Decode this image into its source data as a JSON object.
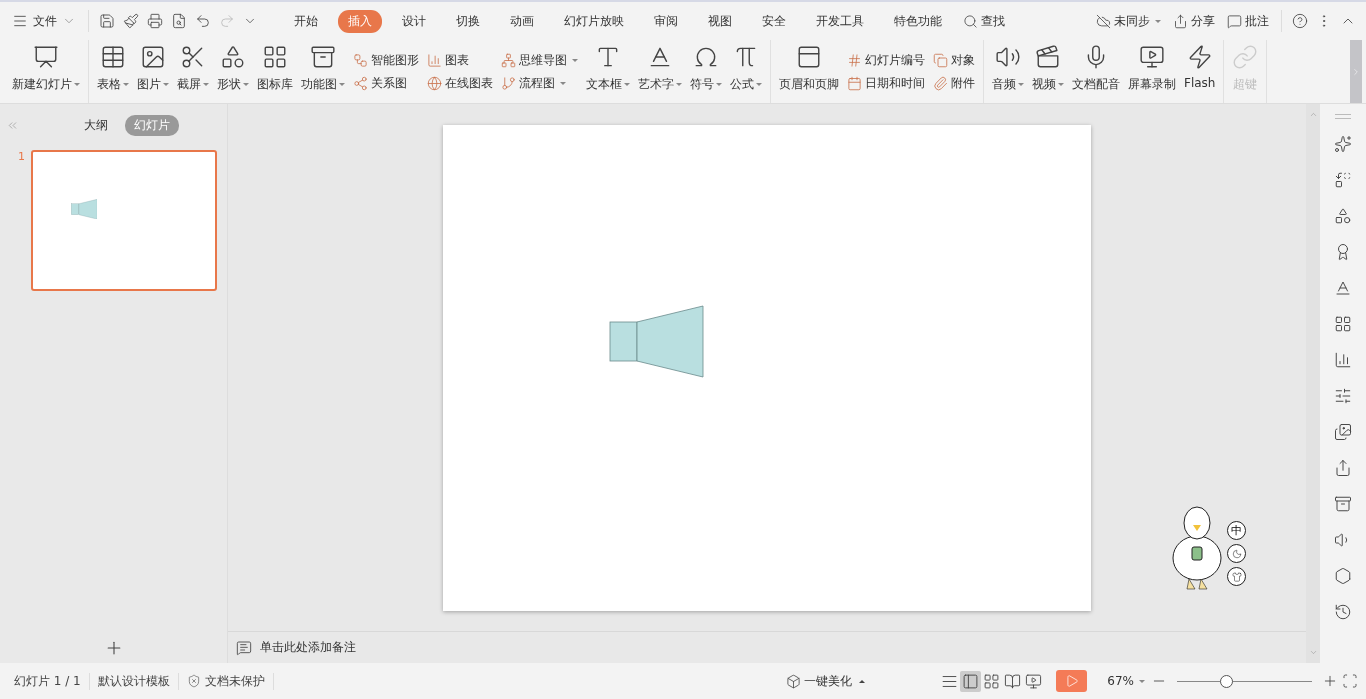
{
  "menu": {
    "label": "文件"
  },
  "tabs": [
    {
      "label": "开始",
      "selected": false
    },
    {
      "label": "插入",
      "selected": true
    },
    {
      "label": "设计",
      "selected": false
    },
    {
      "label": "切换",
      "selected": false
    },
    {
      "label": "动画",
      "selected": false
    },
    {
      "label": "幻灯片放映",
      "selected": false
    },
    {
      "label": "审阅",
      "selected": false
    },
    {
      "label": "视图",
      "selected": false
    },
    {
      "label": "安全",
      "selected": false
    },
    {
      "label": "开发工具",
      "selected": false
    },
    {
      "label": "特色功能",
      "selected": false
    }
  ],
  "search": {
    "label": "查找"
  },
  "top_actions": [
    {
      "label": "未同步",
      "dropdown": true
    },
    {
      "label": "分享",
      "dropdown": false
    },
    {
      "label": "批注",
      "dropdown": false
    }
  ],
  "ribbon": {
    "groups": [
      {
        "columns": [
          {
            "kind": "large",
            "label": "新建幻灯片",
            "dropdown": true,
            "disabled": false
          }
        ]
      },
      {
        "columns": [
          {
            "kind": "large",
            "label": "表格",
            "dropdown": true,
            "disabled": false
          },
          {
            "kind": "large",
            "label": "图片",
            "dropdown": true,
            "disabled": false
          },
          {
            "kind": "large",
            "label": "截屏",
            "dropdown": true,
            "disabled": false
          },
          {
            "kind": "large",
            "label": "形状",
            "dropdown": true,
            "disabled": false
          },
          {
            "kind": "large",
            "label": "图标库",
            "dropdown": false,
            "disabled": false
          },
          {
            "kind": "large",
            "label": "功能图",
            "dropdown": true,
            "disabled": false
          },
          {
            "kind": "stack",
            "items": [
              {
                "label": "智能图形",
                "dropdown": false
              },
              {
                "label": "关系图",
                "dropdown": false
              }
            ]
          },
          {
            "kind": "stack",
            "items": [
              {
                "label": "图表",
                "dropdown": false
              },
              {
                "label": "在线图表",
                "dropdown": false
              }
            ]
          },
          {
            "kind": "stack",
            "items": [
              {
                "label": "思维导图",
                "dropdown": true
              },
              {
                "label": "流程图",
                "dropdown": true
              }
            ]
          },
          {
            "kind": "large",
            "label": "文本框",
            "dropdown": true,
            "disabled": false
          },
          {
            "kind": "large",
            "label": "艺术字",
            "dropdown": true,
            "disabled": false
          },
          {
            "kind": "large",
            "label": "符号",
            "dropdown": true,
            "disabled": false
          },
          {
            "kind": "large",
            "label": "公式",
            "dropdown": true,
            "disabled": false
          }
        ]
      },
      {
        "columns": [
          {
            "kind": "large",
            "label": "页眉和页脚",
            "dropdown": false,
            "disabled": false
          },
          {
            "kind": "stack",
            "items": [
              {
                "label": "幻灯片编号",
                "dropdown": false
              },
              {
                "label": "日期和时间",
                "dropdown": false
              }
            ]
          },
          {
            "kind": "stack",
            "items": [
              {
                "label": "对象",
                "dropdown": false
              },
              {
                "label": "附件",
                "dropdown": false
              }
            ]
          }
        ]
      },
      {
        "columns": [
          {
            "kind": "large",
            "label": "音频",
            "dropdown": true,
            "disabled": false
          },
          {
            "kind": "large",
            "label": "视频",
            "dropdown": true,
            "disabled": false
          },
          {
            "kind": "large",
            "label": "文档配音",
            "dropdown": false,
            "disabled": false
          },
          {
            "kind": "large",
            "label": "屏幕录制",
            "dropdown": false,
            "disabled": false
          },
          {
            "kind": "large",
            "label": "Flash",
            "dropdown": false,
            "disabled": false
          }
        ]
      },
      {
        "columns": [
          {
            "kind": "large",
            "label": "超键",
            "dropdown": false,
            "disabled": true
          }
        ]
      }
    ]
  },
  "panel_tabs": [
    {
      "label": "大纲",
      "selected": false
    },
    {
      "label": "幻灯片",
      "selected": true
    }
  ],
  "slides": [
    {
      "number": "1",
      "selected": true
    }
  ],
  "notes": {
    "placeholder": "单击此处添加备注"
  },
  "ime": {
    "mode": "中"
  },
  "status_bar": {
    "slide": "幻灯片 1 / 1",
    "template": "默认设计模板",
    "protection": "文档未保护",
    "beautify": "一键美化",
    "zoom": "67%",
    "zoom_level": {
      "level": 0.36
    }
  },
  "views": [
    {
      "kind": "normal",
      "selected": true
    },
    {
      "kind": "sorter",
      "selected": false
    },
    {
      "kind": "reading",
      "selected": false
    },
    {
      "kind": "presenter",
      "selected": false
    }
  ]
}
